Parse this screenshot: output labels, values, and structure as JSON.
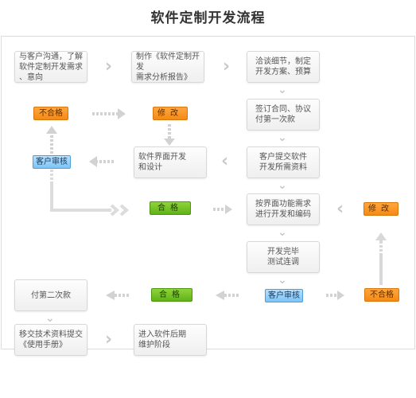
{
  "title": "软件定制开发流程",
  "steps": {
    "communicate": "与客户沟通，了解\n软件定制开发需求\n、意向",
    "make_report": "制作《软件定制开发\n需求分析报告》",
    "negotiate": "洽谈细节，制定\n开发方案、预算",
    "sign_contract": "签订合同、协议\n付第一次款",
    "submit_materials": "客户提交软件\n开发所需资料",
    "ui_design": "软件界面开发\n和设计",
    "develop": "按界面功能需求\n进行开发和编码",
    "test": "开发完毕\n测试连调",
    "second_payment": "付第二次款",
    "handover": "移交技术资料提交\n《使用手册》",
    "maintenance": "进入软件后期\n维护阶段"
  },
  "tags": {
    "fail_1": "不合格",
    "modify_1": "修改",
    "review_1": "客户审核",
    "pass_1": "合格",
    "modify_2": "修改",
    "review_2": "客户审核",
    "pass_2": "合格",
    "fail_2": "不合格"
  },
  "colors": {
    "fail": "#f58a14",
    "modify": "#f58a14",
    "review": "#7cc4f7",
    "pass": "#5fb317",
    "arrow": "#c8c8c8"
  }
}
